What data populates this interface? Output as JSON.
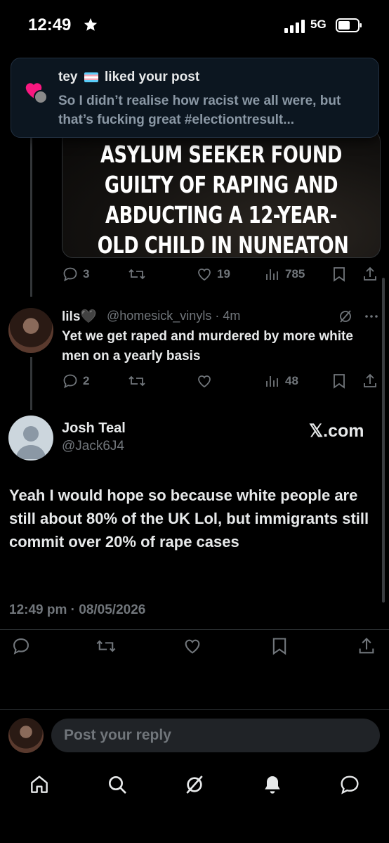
{
  "status_bar": {
    "time": "12:49",
    "network": "5G"
  },
  "notification": {
    "title": "liked your post",
    "username": "tey",
    "body": "So I didn’t realise how racist we all were, but that’s fucking great  #electiontresult..."
  },
  "quoted_post": {
    "headline_lines": [
      "ASYLUM SEEKER FOUND",
      "GUILTY OF RAPING AND",
      "ABDUCTING A 12-YEAR-",
      "OLD CHILD IN NUNEATON"
    ],
    "replies": "3",
    "likes": "19",
    "views": "785"
  },
  "reply": {
    "name": "lils🖤",
    "handle_time": "@homesick_vinyls · 4m",
    "text": "Yet we get raped and murdered by more white men on a yearly basis",
    "replies": "2",
    "views": "48"
  },
  "main_tweet": {
    "name": "Josh Teal",
    "handle": "@Jack6J4",
    "source": "𝕏.com",
    "text": "Yeah I would hope so because white people are still about 80% of the UK Lol, but immigrants still commit over 20% of rape cases",
    "timestamp": "12:49 pm · 08/05/2026"
  },
  "reply_bar": {
    "placeholder": "Post your reply"
  },
  "icons": {
    "reply": "reply-icon",
    "retweet": "retweet-icon",
    "like": "heart-icon",
    "views": "views-icon",
    "bookmark": "bookmark-icon",
    "share": "share-icon",
    "grok": "grok-icon",
    "more": "more-icon"
  },
  "nav": [
    "home-icon",
    "search-icon",
    "grok-icon",
    "notifications-icon",
    "messages-icon"
  ],
  "colors": {
    "background": "#000000",
    "text": "#e7e9ea",
    "muted": "#71767b",
    "toast_bg": "#0c1620"
  }
}
